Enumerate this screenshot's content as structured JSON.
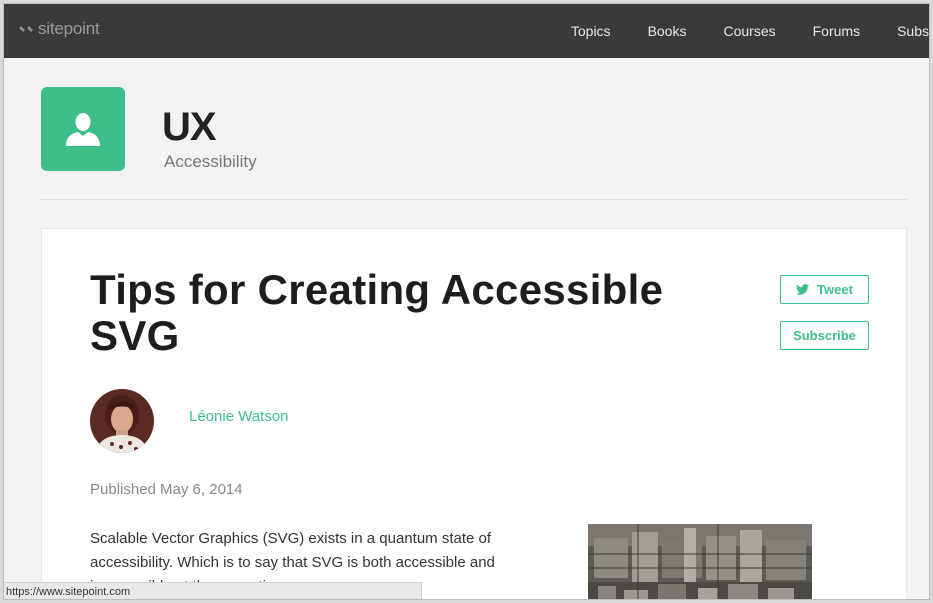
{
  "brand": {
    "logo_text": "sitepoint"
  },
  "nav": {
    "items": [
      {
        "label": "Topics"
      },
      {
        "label": "Books"
      },
      {
        "label": "Courses"
      },
      {
        "label": "Forums"
      },
      {
        "label": "Subs"
      }
    ]
  },
  "category": {
    "icon": "user-icon",
    "title": "UX",
    "subtitle": "Accessibility"
  },
  "article": {
    "title": "Tips for Creating Accessible SVG",
    "tweet_label": "Tweet",
    "subscribe_label": "Subscribe",
    "author_name": "Léonie Watson",
    "published": "Published May 6, 2014",
    "intro": "Scalable Vector Graphics (SVG) exists in a quantum state of accessibility. Which is to say that SVG is both accessible and inaccessible at the same time."
  },
  "status_bar": {
    "url": "https://www.sitepoint.com"
  },
  "colors": {
    "accent": "#3ebf8a",
    "topbar": "#3a3a3a",
    "page_bg": "#f3f3f3"
  }
}
